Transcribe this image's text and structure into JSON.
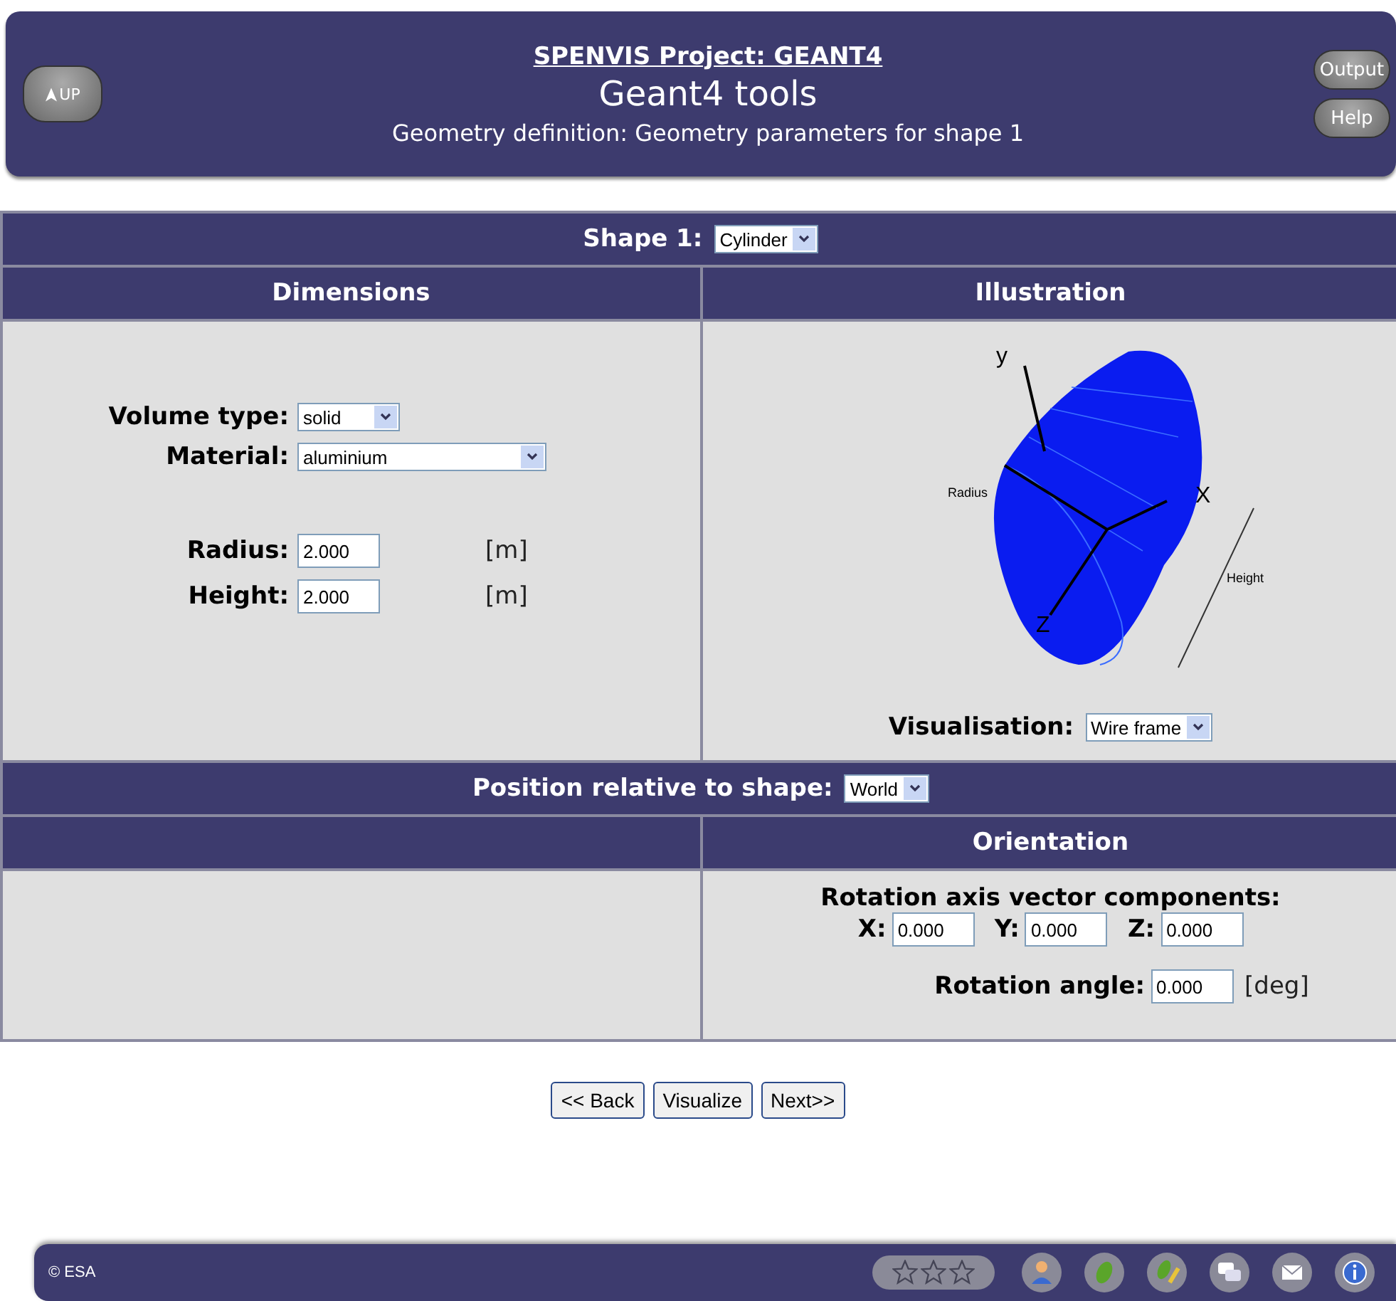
{
  "header": {
    "up_button": "UP",
    "project_link": "SPENVIS Project: GEANT4",
    "title": "Geant4 tools",
    "subtitle": "Geometry definition: Geometry parameters for shape 1",
    "side_buttons": [
      "Output",
      "Help"
    ]
  },
  "shape_row": {
    "label": "Shape 1:",
    "value": "Cylinder"
  },
  "dimensions": {
    "heading": "Dimensions",
    "volume_type": {
      "label": "Volume type:",
      "value": "solid"
    },
    "material": {
      "label": "Material:",
      "value": "aluminium"
    },
    "fields": [
      {
        "label": "Radius:",
        "value": "2.000",
        "unit": "[m]"
      },
      {
        "label": "Height:",
        "value": "2.000",
        "unit": "[m]"
      }
    ]
  },
  "illustration": {
    "heading": "Illustration",
    "labels": {
      "y": "y",
      "x": "X",
      "z": "Z",
      "radius": "Radius",
      "height": "Height"
    },
    "visualisation": {
      "label": "Visualisation:",
      "value": "Wire frame"
    }
  },
  "position_row": {
    "label": "Position relative to shape:",
    "value": "World"
  },
  "orientation": {
    "heading": "Orientation",
    "axis_label": "Rotation axis vector components:",
    "components": [
      {
        "label": "X:",
        "value": "0.000"
      },
      {
        "label": "Y:",
        "value": "0.000"
      },
      {
        "label": "Z:",
        "value": "0.000"
      }
    ],
    "angle": {
      "label": "Rotation angle:",
      "value": "0.000",
      "unit": "[deg]"
    }
  },
  "buttons": [
    "<< Back",
    "Visualize",
    "Next>>"
  ],
  "footer": {
    "copyright": "© ESA",
    "stars": 0,
    "icons": [
      {
        "kind": "person"
      },
      {
        "kind": "leaf"
      },
      {
        "kind": "pencil"
      },
      {
        "kind": "chat"
      },
      {
        "kind": "mail"
      },
      {
        "kind": "info"
      }
    ]
  }
}
